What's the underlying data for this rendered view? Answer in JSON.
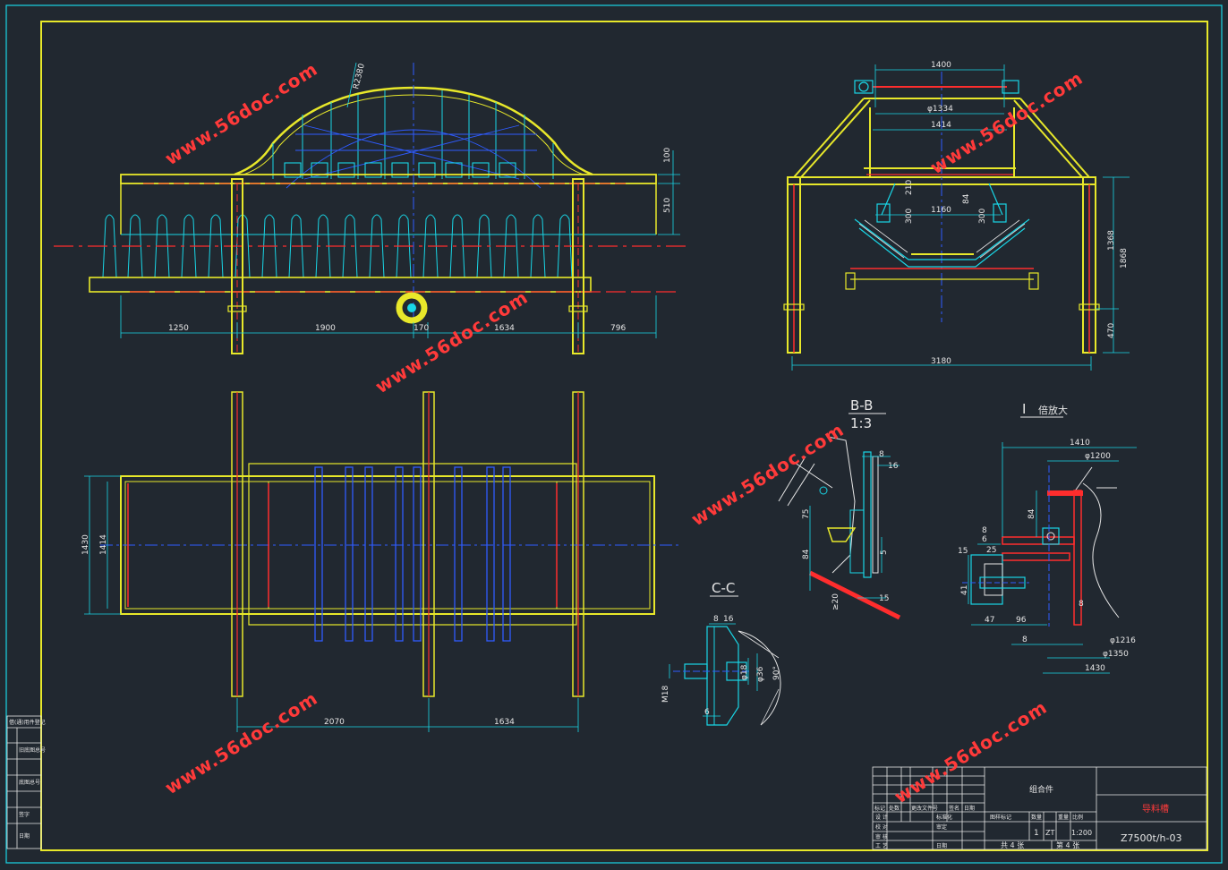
{
  "views": {
    "bb_title": "B-B",
    "bb_scale": "1:3",
    "cc_title": "C-C",
    "detail_title": "I",
    "detail_sub": "倍放大"
  },
  "dims": {
    "front": [
      "1250",
      "1900",
      "170",
      "1634",
      "796",
      "100",
      "510",
      "R2380"
    ],
    "side": [
      "1400",
      "φ1334",
      "1414",
      "1160",
      "210",
      "84",
      "300",
      "300",
      "1368",
      "1868",
      "470",
      "3180"
    ],
    "plan": [
      "1430",
      "1414",
      "2070",
      "1634"
    ],
    "bb": [
      "8",
      "16",
      "75",
      "84",
      "5",
      "≥20",
      "15"
    ],
    "cc": [
      "8",
      "16",
      "M18",
      "φ18",
      "φ36",
      "90°",
      "6"
    ],
    "detail": [
      "1410",
      "φ1200",
      "84",
      "8",
      "6",
      "25",
      "15",
      "41",
      "47",
      "96",
      "8",
      "8",
      "φ1216",
      "φ1350",
      "1430"
    ]
  },
  "watermark": "www.56doc.com",
  "title_block": {
    "assembly_label": "组合件",
    "drawing_title": "导料槽",
    "drawing_number": "Z7500t/h-03",
    "qty": "1",
    "material": "ZT",
    "scale": "1:200",
    "sheet_total": "共 4 张",
    "sheet_no": "第 4 张",
    "row_labels": [
      "设 计",
      "校 对",
      "审 核",
      "工 艺"
    ],
    "col_labels": [
      "标记",
      "处数",
      "更改文件号",
      "签名",
      "日期"
    ],
    "head_labels": [
      "图样标记",
      "数量",
      "重量",
      "比例"
    ],
    "mid_labels": [
      "标准化",
      "审定",
      "日期"
    ],
    "side_labels": [
      "借(通)用件登记",
      "旧底图总号",
      "底图总号",
      "签字",
      "日期"
    ]
  },
  "colors": {
    "background": "#212830",
    "frame": "#e8e82a",
    "cyan": "#19d6e6",
    "blue": "#2f5bff",
    "red": "#ff2d2d",
    "white": "#e6e6e6",
    "watermark": "#ff3a3a"
  }
}
